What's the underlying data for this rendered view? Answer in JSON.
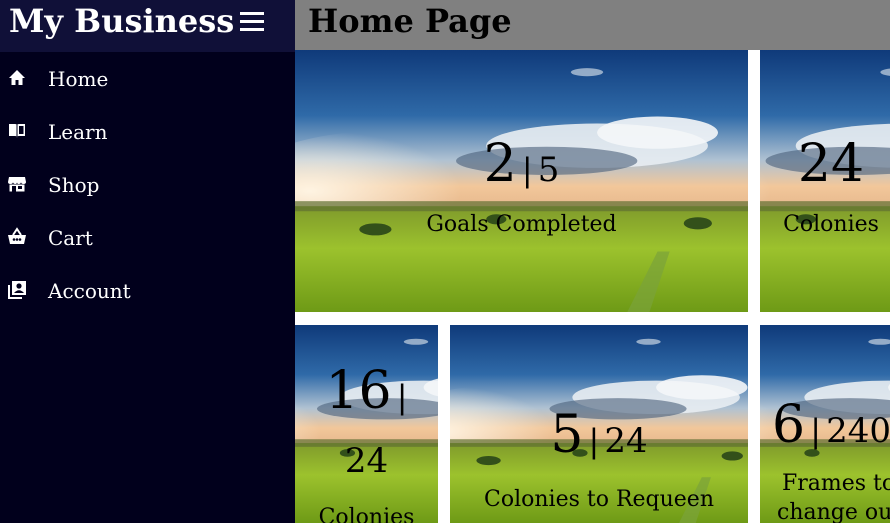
{
  "app": {
    "title": "My Business"
  },
  "header": {
    "title": "Home Page"
  },
  "sidebar": {
    "items": [
      {
        "label": "Home",
        "icon": "home-icon"
      },
      {
        "label": "Learn",
        "icon": "book-icon"
      },
      {
        "label": "Shop",
        "icon": "store-icon"
      },
      {
        "label": "Cart",
        "icon": "basket-icon"
      },
      {
        "label": "Account",
        "icon": "account-icon"
      }
    ]
  },
  "cards": [
    {
      "value": "2",
      "separator": "|",
      "total": "5",
      "label": "Goals Completed"
    },
    {
      "value": "24",
      "label": "Colonies"
    },
    {
      "value": "16",
      "separator": "|",
      "total": "24",
      "label": "Colonies"
    },
    {
      "value": "5",
      "separator": "|",
      "total": "24",
      "label": "Colonies to Requeen"
    },
    {
      "value": "6",
      "separator": "|",
      "total": "240",
      "label_line1": "Frames to",
      "label_line2": "change out"
    }
  ],
  "colors": {
    "sidebar_bg": "#01001c",
    "brand_bg": "#101038",
    "header_bg": "#808080"
  }
}
